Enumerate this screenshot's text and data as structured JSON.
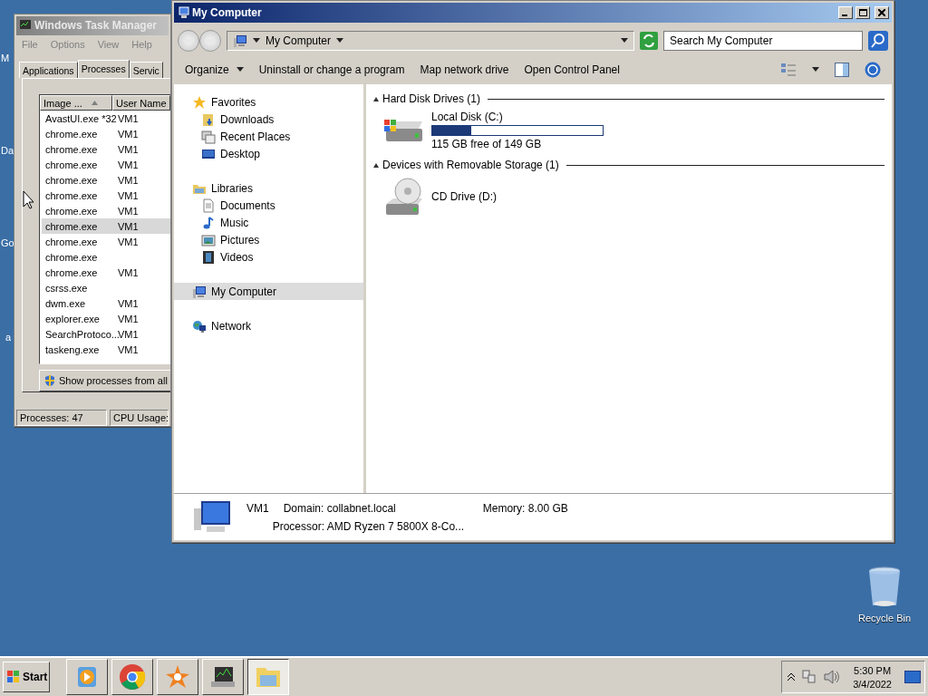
{
  "desktop": {
    "edge_labels": [
      "M",
      "Da",
      "Go",
      "a"
    ],
    "recycle_bin": {
      "label": "Recycle Bin"
    }
  },
  "task_manager": {
    "title": "Windows Task Manager",
    "menu": [
      "File",
      "Options",
      "View",
      "Help"
    ],
    "tabs": [
      {
        "label": "Applications",
        "selected": false
      },
      {
        "label": "Processes",
        "selected": true
      },
      {
        "label": "Servic",
        "selected": false
      }
    ],
    "columns": [
      "Image ...",
      "User Name"
    ],
    "rows": [
      {
        "image": "AvastUI.exe *32",
        "user": "VM1",
        "selected": false
      },
      {
        "image": "chrome.exe",
        "user": "VM1",
        "selected": false
      },
      {
        "image": "chrome.exe",
        "user": "VM1",
        "selected": false
      },
      {
        "image": "chrome.exe",
        "user": "VM1",
        "selected": false
      },
      {
        "image": "chrome.exe",
        "user": "VM1",
        "selected": false
      },
      {
        "image": "chrome.exe",
        "user": "VM1",
        "selected": false
      },
      {
        "image": "chrome.exe",
        "user": "VM1",
        "selected": false
      },
      {
        "image": "chrome.exe",
        "user": "VM1",
        "selected": true
      },
      {
        "image": "chrome.exe",
        "user": "VM1",
        "selected": false
      },
      {
        "image": "chrome.exe",
        "selected": false
      },
      {
        "image": "chrome.exe",
        "user": "VM1",
        "selected": false
      },
      {
        "image": "csrss.exe",
        "selected": false
      },
      {
        "image": "dwm.exe",
        "user": "VM1",
        "selected": false
      },
      {
        "image": "explorer.exe",
        "user": "VM1",
        "selected": false
      },
      {
        "image": "SearchProtoco...",
        "user": "VM1",
        "selected": false
      },
      {
        "image": "taskeng.exe",
        "user": "VM1",
        "selected": false
      }
    ],
    "button": "Show processes from all",
    "status": [
      "Processes: 47",
      "CPU Usage:"
    ]
  },
  "explorer": {
    "title": "My Computer",
    "address": "My Computer",
    "search": {
      "placeholder": "Search My Computer"
    },
    "commands": [
      {
        "label": "Organize",
        "kind": "menu"
      },
      {
        "label": "Uninstall or change a program",
        "kind": "plain"
      },
      {
        "label": "Map network drive",
        "kind": "plain"
      },
      {
        "label": "Open Control Panel",
        "kind": "plain"
      }
    ],
    "nav": [
      {
        "label": "Favorites",
        "kind": "star",
        "selected": false,
        "children": [
          {
            "label": "Downloads",
            "kind": "downloads",
            "selected": false
          },
          {
            "label": "Recent Places",
            "kind": "recent",
            "selected": false
          },
          {
            "label": "Desktop",
            "kind": "desktop",
            "selected": false
          }
        ]
      },
      {
        "label": "Libraries",
        "kind": "library",
        "selected": false,
        "children": [
          {
            "label": "Documents",
            "kind": "document",
            "selected": false
          },
          {
            "label": "Music",
            "kind": "music",
            "selected": false
          },
          {
            "label": "Pictures",
            "kind": "pictures",
            "selected": false
          },
          {
            "label": "Videos",
            "kind": "videos",
            "selected": false
          }
        ]
      },
      {
        "label": "My Computer",
        "kind": "computer",
        "selected": true
      },
      {
        "label": "Network",
        "kind": "network",
        "selected": false
      }
    ],
    "groups": [
      {
        "label": "Hard Disk Drives (1)",
        "expanded": true,
        "items": [
          {
            "name": "Local Disk (C:)",
            "kind": "disk",
            "level": 0.23,
            "free": "115 GB free of 149 GB"
          }
        ]
      },
      {
        "label": "Devices with Removable Storage (1)",
        "expanded": true,
        "items": [
          {
            "name": "CD Drive (D:)",
            "kind": "cd"
          }
        ]
      }
    ],
    "details": {
      "name": "VM1",
      "domain": "Domain: collabnet.local",
      "memory": "Memory: 8.00 GB",
      "processor": "Processor: AMD Ryzen 7 5800X 8-Co..."
    }
  },
  "taskbar": {
    "start": "Start",
    "apps": [
      {
        "kind": "media",
        "selected": false
      },
      {
        "kind": "browser",
        "selected": false
      },
      {
        "kind": "antivirus",
        "selected": false
      },
      {
        "kind": "monitor",
        "selected": false
      },
      {
        "kind": "folder",
        "selected": true
      }
    ],
    "clock": {
      "time": "5:30 PM",
      "date": "3/4/2022"
    }
  }
}
